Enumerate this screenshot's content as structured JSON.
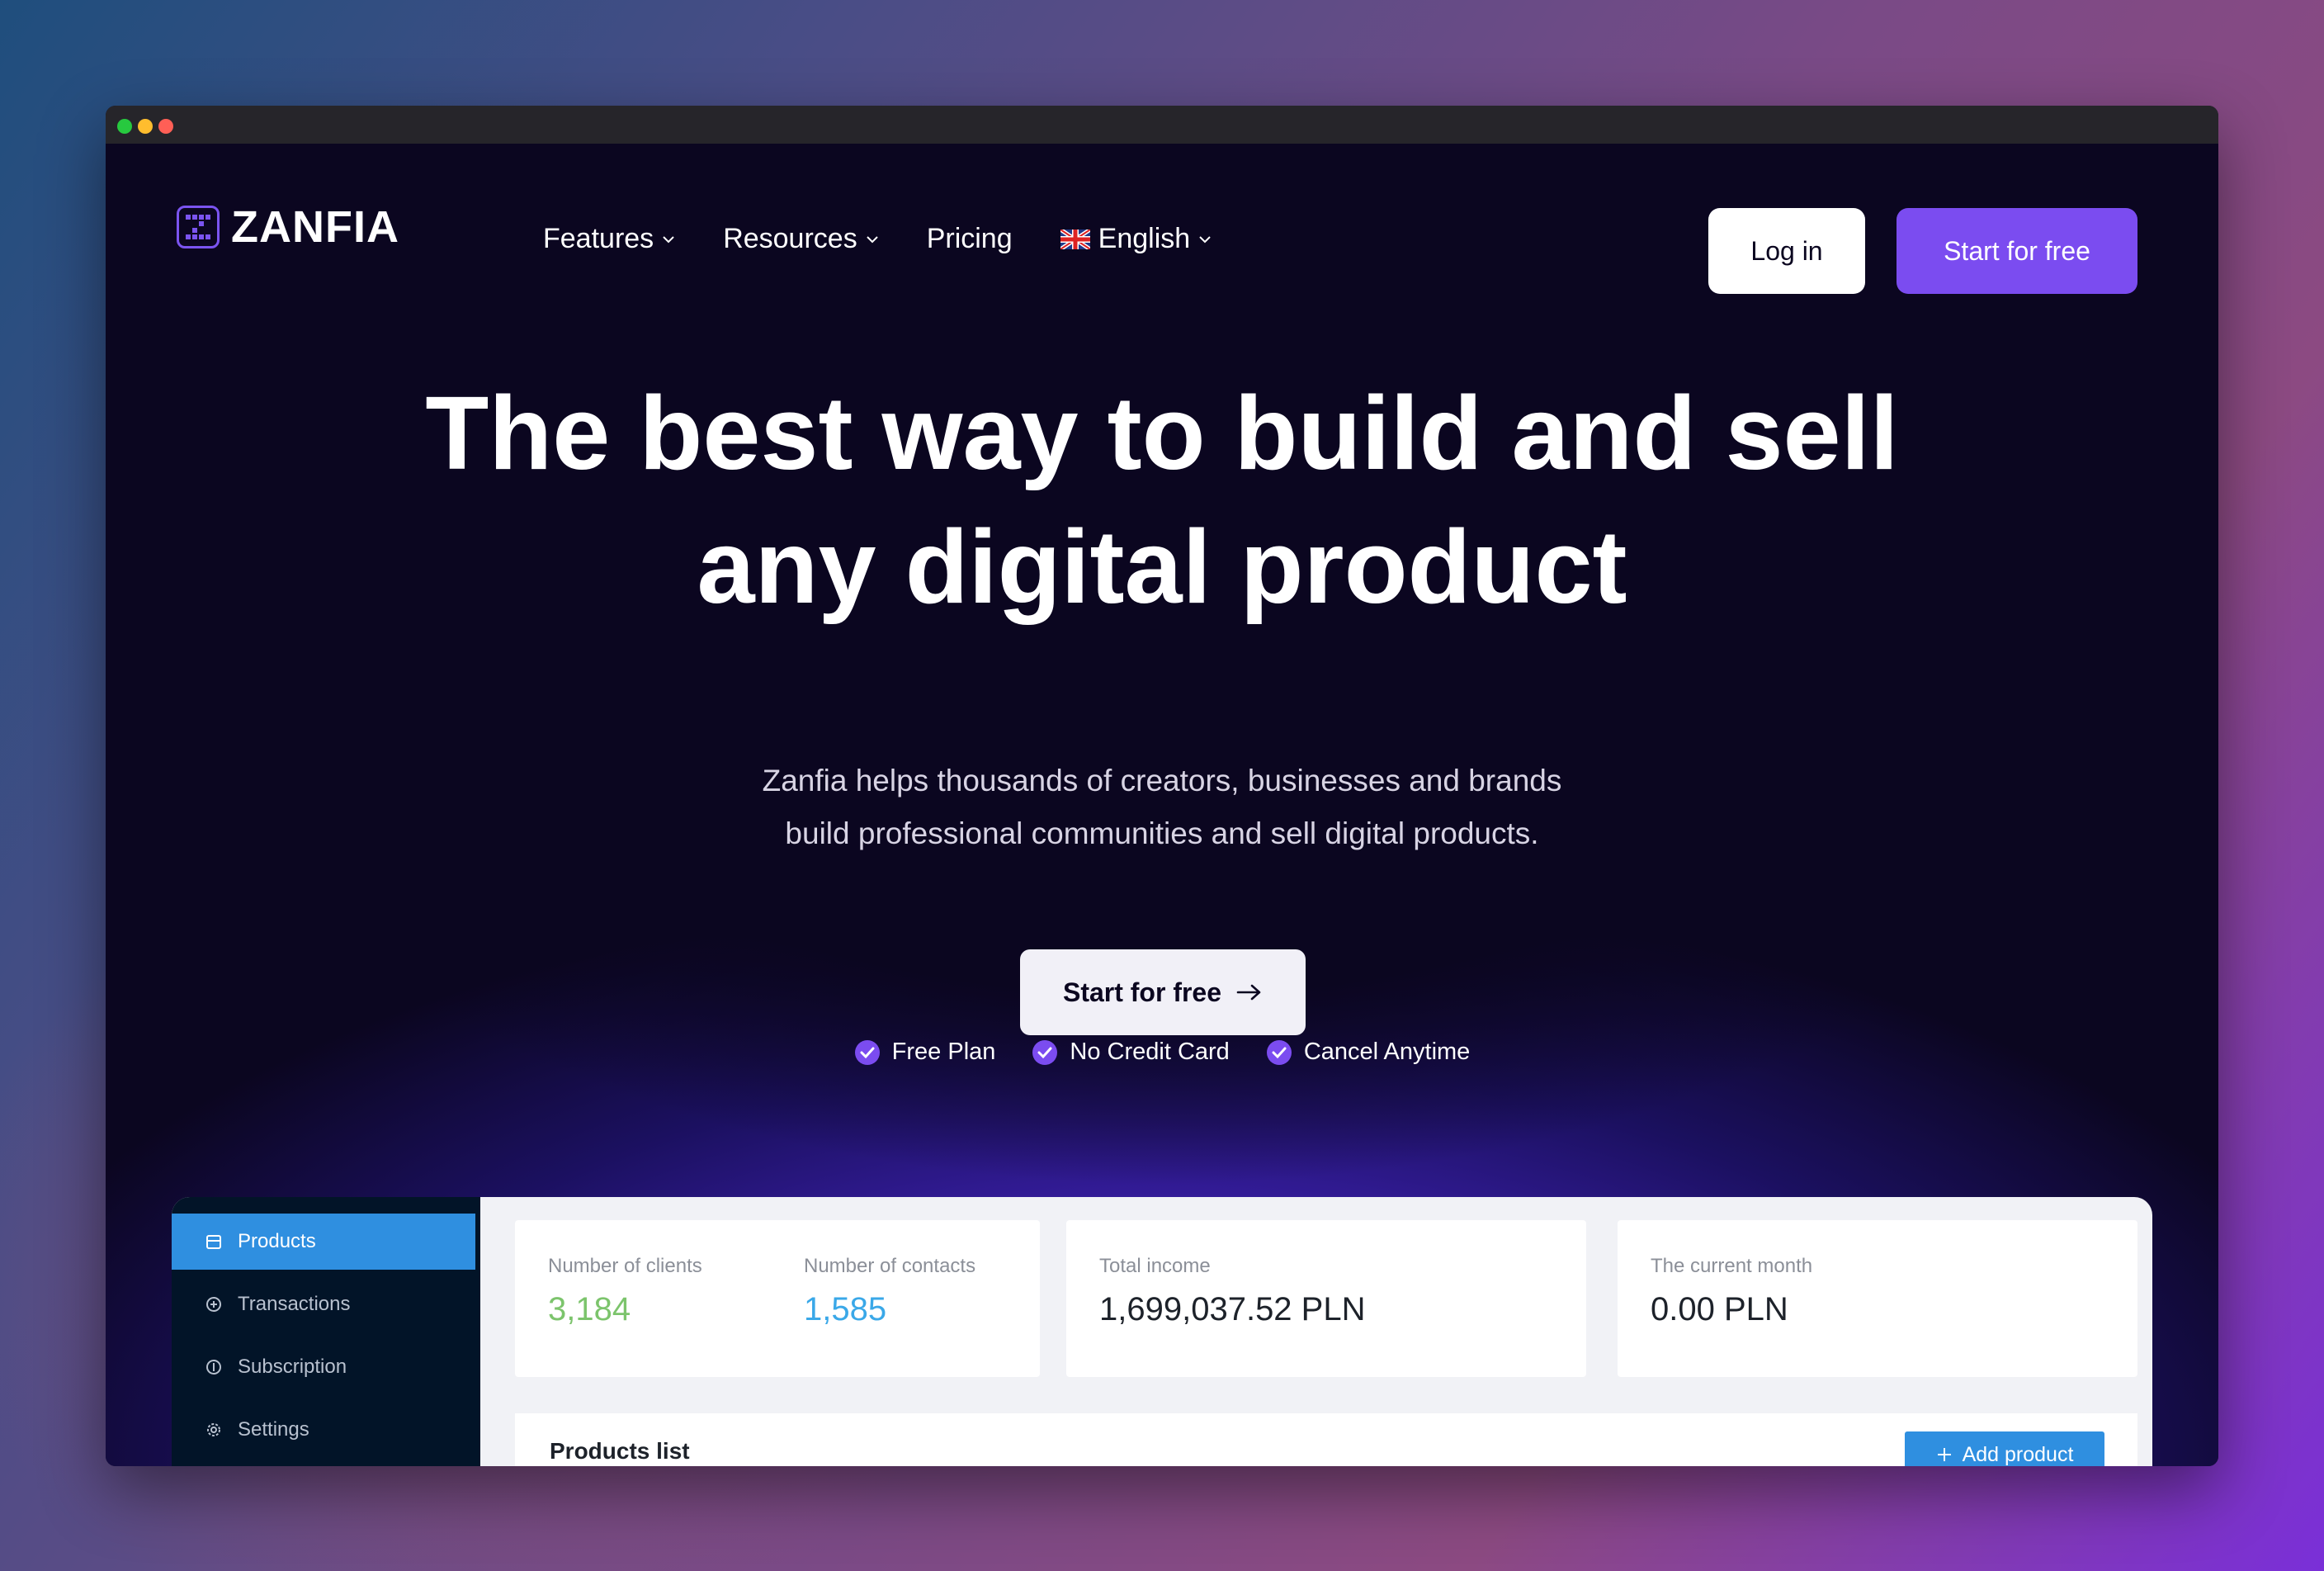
{
  "brand": {
    "name": "ZANFIA"
  },
  "nav": {
    "features": "Features",
    "resources": "Resources",
    "pricing": "Pricing",
    "language": "English",
    "login": "Log in",
    "start": "Start for free"
  },
  "hero": {
    "title_prefix": "The best way to ",
    "title_highlight": "build and sell",
    "title_line2": "any digital product",
    "sub_line1": "Zanfia helps thousands of creators, businesses and brands",
    "sub_line2": "build professional communities and sell digital products.",
    "cta": "Start for free",
    "checks": [
      "Free Plan",
      "No Credit Card",
      "Cancel Anytime"
    ]
  },
  "dashboard": {
    "sidebar": [
      "Products",
      "Transactions",
      "Subscription",
      "Settings"
    ],
    "stats": {
      "clients_label": "Number of clients",
      "clients_value": "3,184",
      "contacts_label": "Number of contacts",
      "contacts_value": "1,585",
      "income_label": "Total income",
      "income_value": "1,699,037.52 PLN",
      "month_label": "The current month",
      "month_value": "0.00 PLN"
    },
    "products_title": "Products list",
    "add_product": "Add product"
  },
  "colors": {
    "accent": "#7b4cf0",
    "dash_blue": "#2f8fe0",
    "clients_green": "#7cc46c",
    "contacts_blue": "#3aa8e8"
  }
}
